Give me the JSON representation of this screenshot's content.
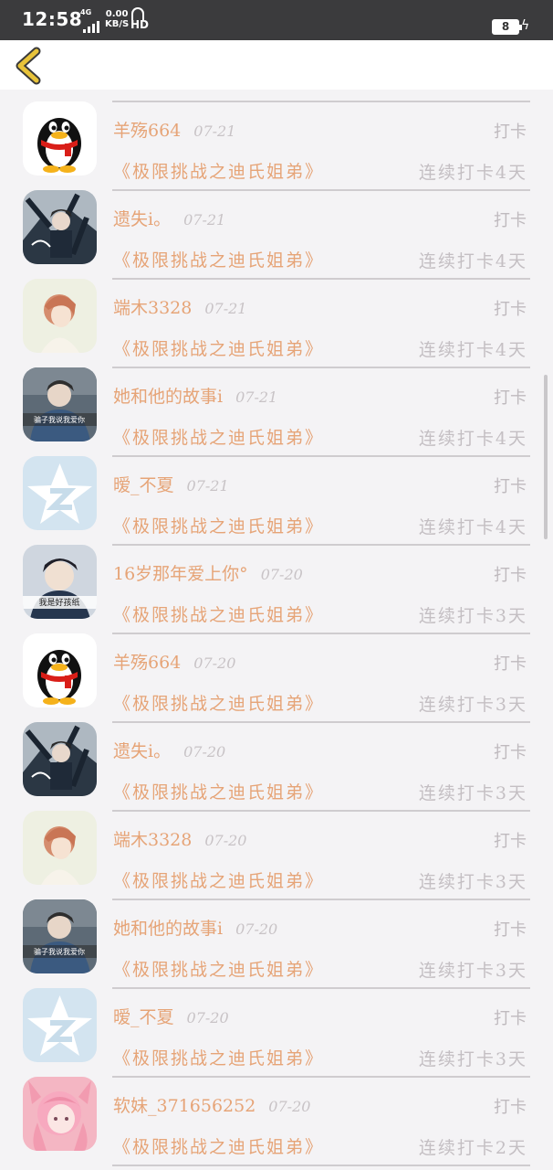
{
  "status": {
    "time": "12:58",
    "network": "4G",
    "speed_value": "0.00",
    "speed_unit": "KB/S",
    "hd": "HD",
    "battery": "8"
  },
  "colors": {
    "accent": "#e6a477",
    "muted": "#c4bfc3",
    "divider": "#cfcccf",
    "back_arrow": "#e8c33a"
  },
  "icons": {
    "back": "chevron-left-icon",
    "charging": "bolt-icon"
  },
  "rows": [
    {
      "user": "羊殇664",
      "date": "07-21",
      "action": "打卡",
      "course": "《极限挑战之迪氏姐弟》",
      "streak": "连续打卡4天",
      "avatar": "qq-penguin"
    },
    {
      "user": "遗失i。",
      "date": "07-21",
      "action": "打卡",
      "course": "《极限挑战之迪氏姐弟》",
      "streak": "连续打卡4天",
      "avatar": "anime-boy"
    },
    {
      "user": "端木3328",
      "date": "07-21",
      "action": "打卡",
      "course": "《极限挑战之迪氏姐弟》",
      "streak": "连续打卡4天",
      "avatar": "redhair-girl"
    },
    {
      "user": "她和他的故事i",
      "date": "07-21",
      "action": "打卡",
      "course": "《极限挑战之迪氏姐弟》",
      "streak": "连续打卡4天",
      "avatar": "boy-denim"
    },
    {
      "user": "暧_不夏",
      "date": "07-21",
      "action": "打卡",
      "course": "《极限挑战之迪氏姐弟》",
      "streak": "连续打卡4天",
      "avatar": "qzone-star"
    },
    {
      "user": "16岁那年爱上你°",
      "date": "07-20",
      "action": "打卡",
      "course": "《极限挑战之迪氏姐弟》",
      "streak": "连续打卡3天",
      "avatar": "boy-caption"
    },
    {
      "user": "羊殇664",
      "date": "07-20",
      "action": "打卡",
      "course": "《极限挑战之迪氏姐弟》",
      "streak": "连续打卡3天",
      "avatar": "qq-penguin"
    },
    {
      "user": "遗失i。",
      "date": "07-20",
      "action": "打卡",
      "course": "《极限挑战之迪氏姐弟》",
      "streak": "连续打卡3天",
      "avatar": "anime-boy"
    },
    {
      "user": "端木3328",
      "date": "07-20",
      "action": "打卡",
      "course": "《极限挑战之迪氏姐弟》",
      "streak": "连续打卡3天",
      "avatar": "redhair-girl"
    },
    {
      "user": "她和他的故事i",
      "date": "07-20",
      "action": "打卡",
      "course": "《极限挑战之迪氏姐弟》",
      "streak": "连续打卡3天",
      "avatar": "boy-denim"
    },
    {
      "user": "暧_不夏",
      "date": "07-20",
      "action": "打卡",
      "course": "《极限挑战之迪氏姐弟》",
      "streak": "连续打卡3天",
      "avatar": "qzone-star"
    },
    {
      "user": "软妹_371656252",
      "date": "07-20",
      "action": "打卡",
      "course": "《极限挑战之迪氏姐弟》",
      "streak": "连续打卡2天",
      "avatar": "pink-anime-girl"
    }
  ],
  "avatar_captions": {
    "boy-denim": "骗子我说我爱你",
    "boy-caption": "我是好孩纸"
  }
}
